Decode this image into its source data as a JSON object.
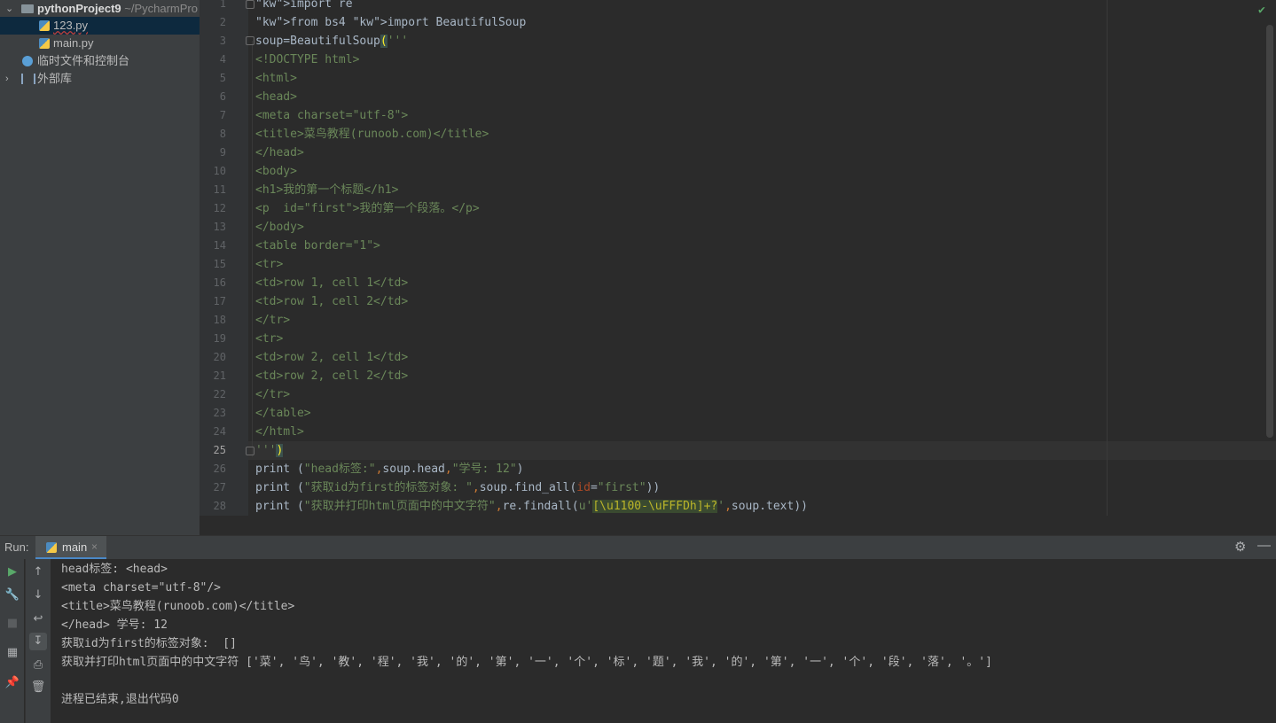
{
  "project_tree": {
    "root_name": "pythonProject9",
    "root_path": "~/PycharmPro",
    "items": [
      {
        "label": "123.py"
      },
      {
        "label": "main.py"
      },
      {
        "label": "临时文件和控制台"
      },
      {
        "label": "外部库"
      }
    ]
  },
  "editor": {
    "line_numbers": [
      "1",
      "2",
      "3",
      "4",
      "5",
      "6",
      "7",
      "8",
      "9",
      "10",
      "11",
      "12",
      "13",
      "14",
      "15",
      "16",
      "17",
      "18",
      "19",
      "20",
      "21",
      "22",
      "23",
      "24",
      "25",
      "26",
      "27",
      "28"
    ],
    "current_line": "25",
    "lines": [
      {
        "plain": "import re"
      },
      {
        "plain": "from bs4 import BeautifulSoup"
      },
      {
        "plain": "soup=BeautifulSoup('''"
      },
      {
        "plain": "<!DOCTYPE html>"
      },
      {
        "plain": "<html>"
      },
      {
        "plain": "<head>"
      },
      {
        "plain": "<meta charset=\"utf-8\">"
      },
      {
        "plain": "<title>菜鸟教程(runoob.com)</title>"
      },
      {
        "plain": "</head>"
      },
      {
        "plain": "<body>"
      },
      {
        "plain": "<h1>我的第一个标题</h1>"
      },
      {
        "plain": "<p  id=\"first\">我的第一个段落。</p>"
      },
      {
        "plain": "</body>"
      },
      {
        "plain": "<table border=\"1\">"
      },
      {
        "plain": "<tr>"
      },
      {
        "plain": "<td>row 1, cell 1</td>"
      },
      {
        "plain": "<td>row 1, cell 2</td>"
      },
      {
        "plain": "</tr>"
      },
      {
        "plain": "<tr>"
      },
      {
        "plain": "<td>row 2, cell 1</td>"
      },
      {
        "plain": "<td>row 2, cell 2</td>"
      },
      {
        "plain": "</tr>"
      },
      {
        "plain": "</table>"
      },
      {
        "plain": "</html>"
      },
      {
        "plain": "''')"
      },
      {
        "plain": "print (\"head标签:\",soup.head,\"学号: 12\")"
      },
      {
        "plain": "print (\"获取id为first的标签对象: \",soup.find_all(id=\"first\"))"
      },
      {
        "plain": "print (\"获取并打印html页面中的中文字符\",re.findall(u'[\\u1100-\\uFFFDh]+?',soup.text))"
      }
    ]
  },
  "run_panel": {
    "title": "Run:",
    "tab_label": "main",
    "output": [
      "head标签: <head>",
      "<meta charset=\"utf-8\"/>",
      "<title>菜鸟教程(runoob.com)</title>",
      "</head> 学号: 12",
      "获取id为first的标签对象:  []",
      "获取并打印html页面中的中文字符 ['菜', '鸟', '教', '程', '我', '的', '第', '一', '个', '标', '题', '我', '的', '第', '一', '个', '段', '落', '。']",
      "",
      "进程已结束,退出代码0"
    ]
  },
  "icons": {
    "run": "run-icon",
    "wrench": "wrench-icon",
    "stop": "stop-icon",
    "layout": "layout-icon",
    "pin": "pin-icon",
    "up": "arrow-up-icon",
    "down": "arrow-down-icon",
    "wrap": "soft-wrap-icon",
    "scroll": "scroll-to-end-icon",
    "print": "print-icon",
    "trash": "trash-icon",
    "gear": "gear-icon",
    "minimize": "minimize-icon",
    "check": "inspection-ok-icon"
  },
  "colors": {
    "keyword": "#cc7832",
    "string": "#6a8759",
    "text": "#a9b7c6",
    "param": "#aa4926",
    "selection": "#0d293e",
    "tab_accent": "#4a88c7",
    "ok_check": "#59a869"
  }
}
